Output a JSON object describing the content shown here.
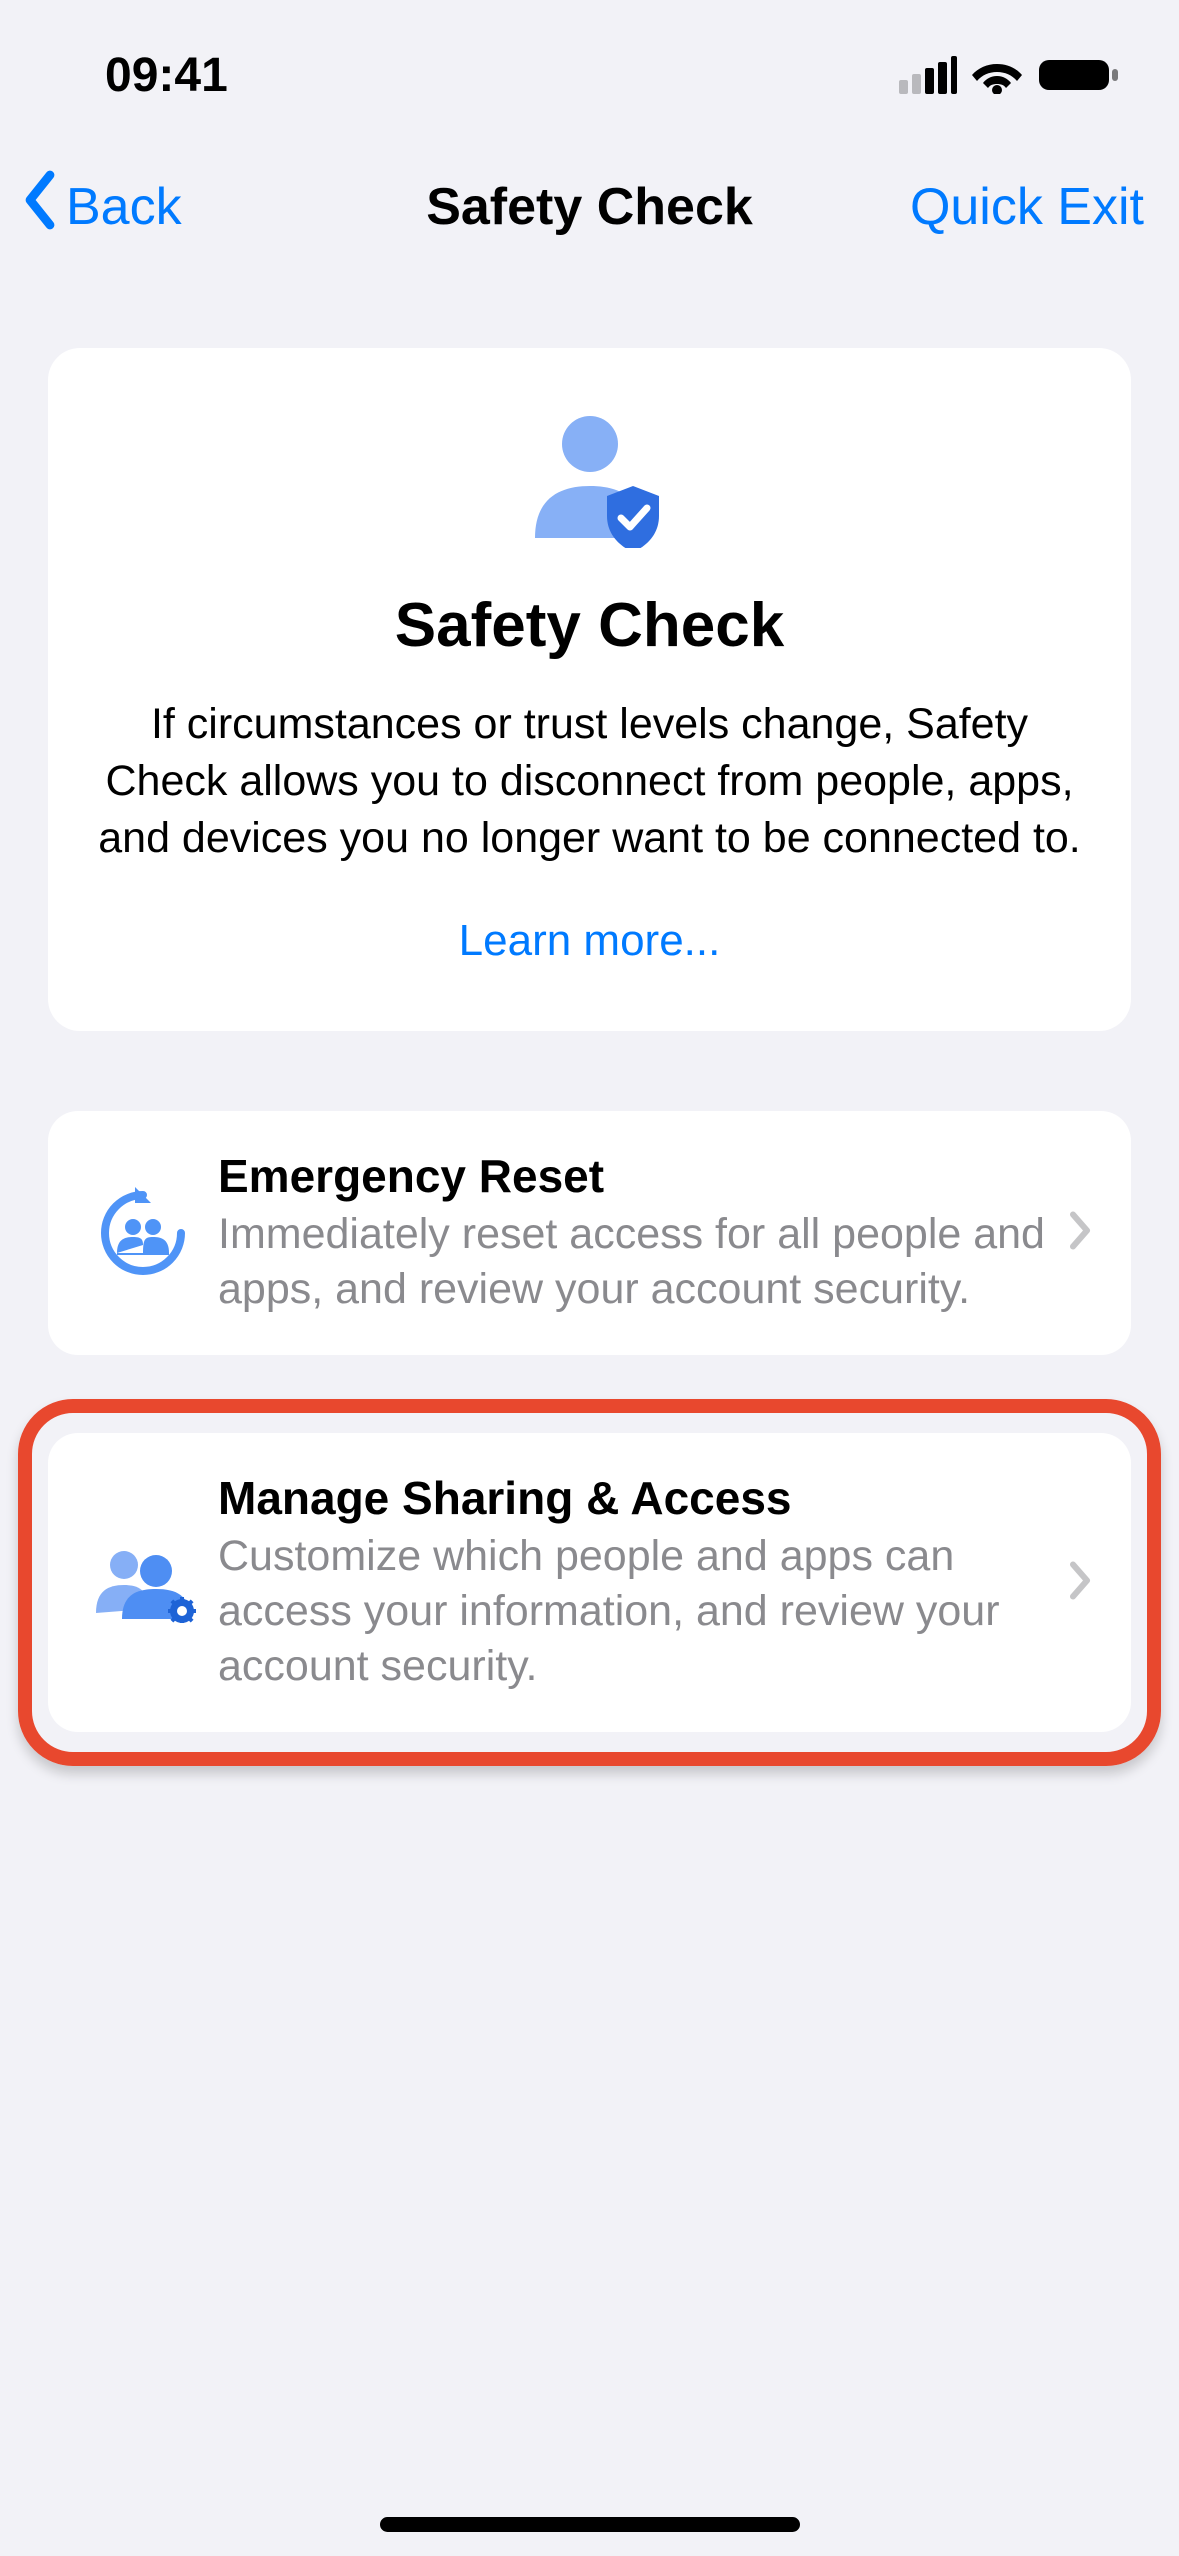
{
  "status": {
    "time": "09:41"
  },
  "nav": {
    "back_label": "Back",
    "title": "Safety Check",
    "right_label": "Quick Exit"
  },
  "intro": {
    "title": "Safety Check",
    "description": "If circumstances or trust levels change, Safety Check allows you to disconnect from people, apps, and devices you no longer want to be connected to.",
    "link": "Learn more..."
  },
  "rows": [
    {
      "title": "Emergency Reset",
      "description": "Immediately reset access for all people and apps, and review your account security."
    },
    {
      "title": "Manage Sharing & Access",
      "description": "Customize which people and apps can access your information, and review your account security."
    }
  ]
}
